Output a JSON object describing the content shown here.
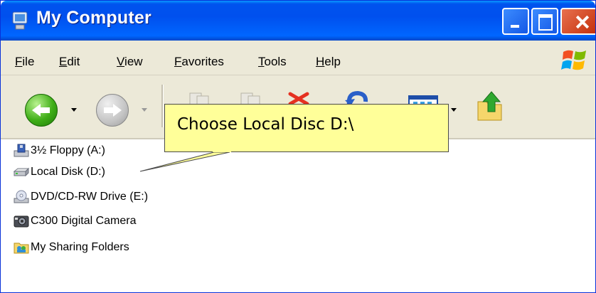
{
  "window": {
    "title": "My Computer"
  },
  "menu": [
    "File",
    "Edit",
    "View",
    "Favorites",
    "Tools",
    "Help"
  ],
  "toolbar": {
    "back": "back-button",
    "forward": "forward-button",
    "icons": [
      "copy-to-icon",
      "move-to-icon",
      "delete-icon",
      "undo-icon",
      "views-icon",
      "up-folder-icon"
    ]
  },
  "items": [
    {
      "label": "3½ Floppy (A:)",
      "icon": "floppy-drive-icon"
    },
    {
      "label": "Local Disk (D:)",
      "icon": "hard-disk-icon"
    },
    {
      "label": "DVD/CD-RW Drive (E:)",
      "icon": "optical-drive-icon"
    },
    {
      "label": "C300 Digital Camera",
      "icon": "camera-icon"
    },
    {
      "label": "My Sharing Folders",
      "icon": "shared-folder-icon"
    }
  ],
  "callout": {
    "text": "Choose Local Disc D:\\"
  },
  "colors": {
    "titlebar": "#0054e3",
    "menubar": "#ece9d8",
    "callout": "#ffff99",
    "close": "#d8502a"
  }
}
